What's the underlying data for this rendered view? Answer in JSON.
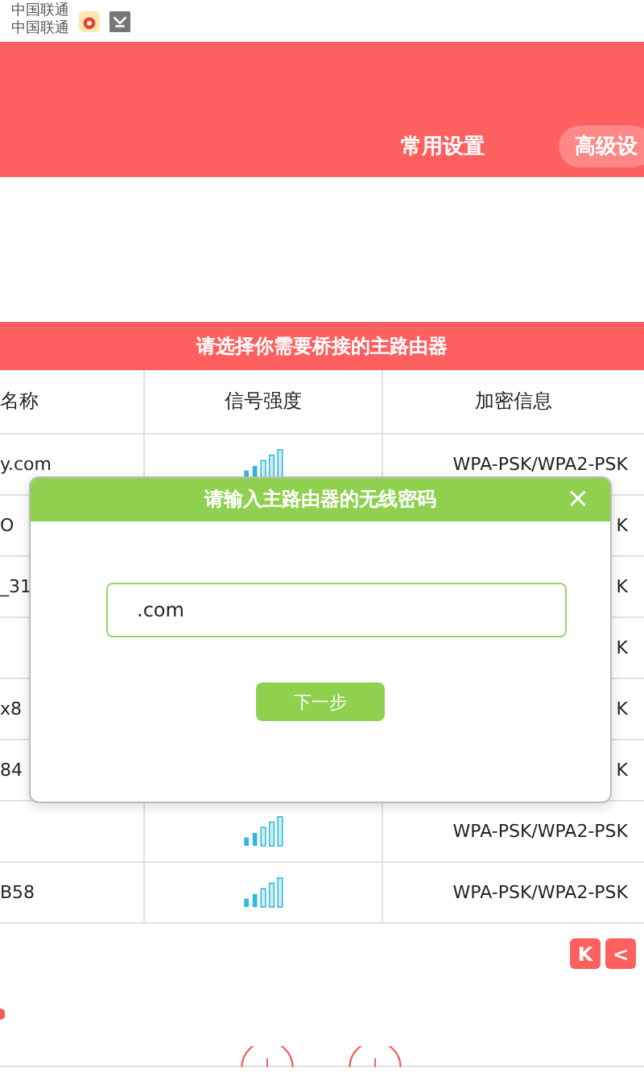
{
  "status_bar": {
    "carrier_lines": [
      "中国联通",
      "中国联通"
    ]
  },
  "header": {
    "tabs": [
      {
        "label": "常用设置",
        "selected": false
      },
      {
        "label": "高级设",
        "selected": true
      }
    ]
  },
  "panel": {
    "title": "请选择你需要桥接的主路由器"
  },
  "table": {
    "columns": [
      "名称",
      "信号强度",
      "加密信息"
    ],
    "rows": [
      {
        "kind": "full",
        "name": "y.com",
        "encryption": "WPA-PSK/WPA2-PSK"
      },
      {
        "kind": "covered",
        "name": "O",
        "encryption": "K"
      },
      {
        "kind": "covered",
        "name": "_31",
        "encryption": "K"
      },
      {
        "kind": "covered",
        "name": "",
        "encryption": "K"
      },
      {
        "kind": "covered",
        "name": "x8",
        "encryption": "K"
      },
      {
        "kind": "covered",
        "name": "84",
        "encryption": "K"
      },
      {
        "kind": "full",
        "name": "",
        "encryption": "WPA-PSK/WPA2-PSK"
      },
      {
        "kind": "full",
        "name": "B58",
        "encryption": "WPA-PSK/WPA2-PSK"
      }
    ]
  },
  "pagination": {
    "buttons": [
      "K",
      "<"
    ]
  },
  "dialog": {
    "title": "请输入主路由器的无线密码",
    "close": "×",
    "password": ".com",
    "button": "下一步"
  }
}
